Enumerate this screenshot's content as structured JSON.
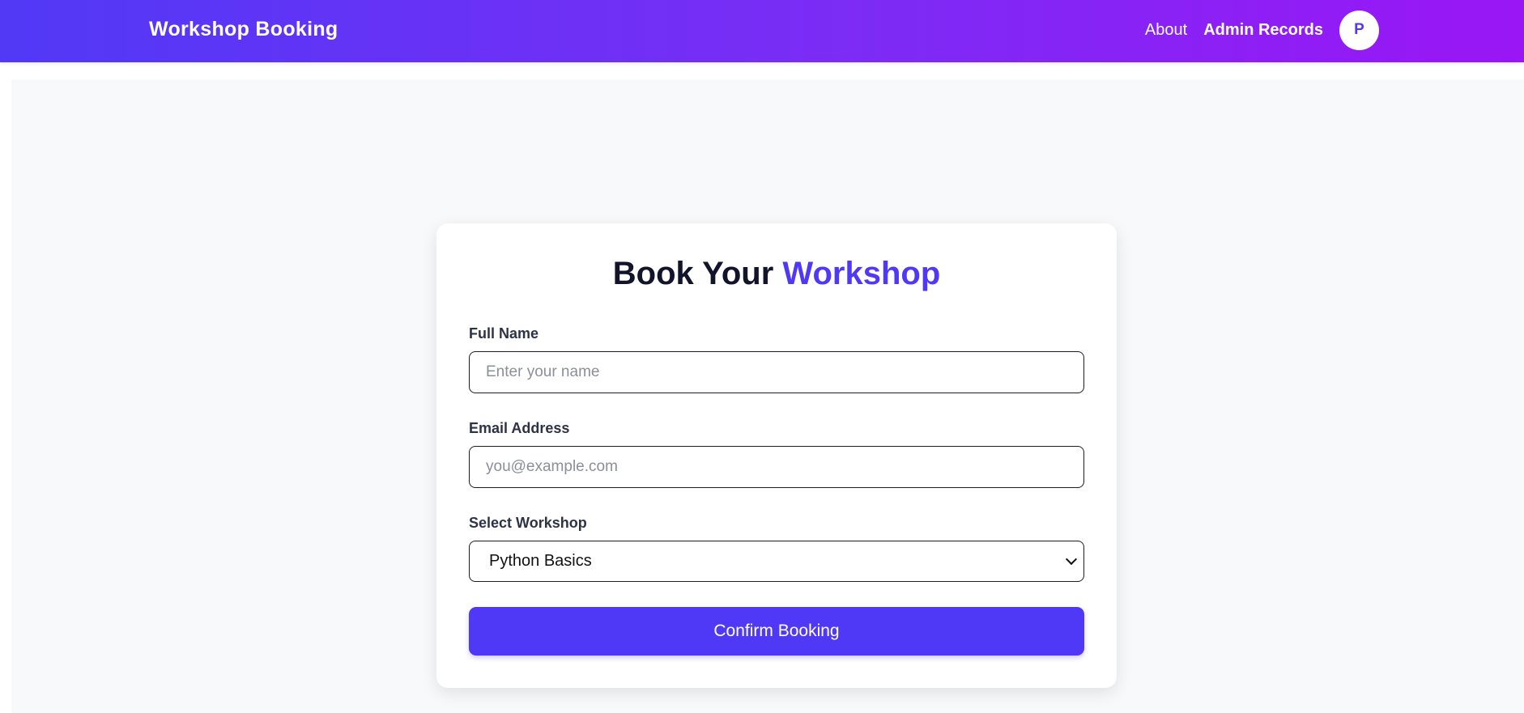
{
  "header": {
    "brand": "Workshop Booking",
    "nav": {
      "about": "About",
      "admin_records": "Admin Records"
    },
    "avatar_initial": "P"
  },
  "form": {
    "title_part1": "Book Your",
    "title_part2": "Workshop",
    "name": {
      "label": "Full Name",
      "placeholder": "Enter your name",
      "value": ""
    },
    "email": {
      "label": "Email Address",
      "placeholder": "you@example.com",
      "value": ""
    },
    "workshop": {
      "label": "Select Workshop",
      "selected": "Python Basics"
    },
    "submit_label": "Confirm Booking"
  },
  "colors": {
    "accent": "#4f39f6",
    "gradient_start": "#5139f6",
    "gradient_end": "#9a16f5",
    "page_background": "#f8f9fb"
  },
  "icons": {
    "select_chevron": "chevron-down-icon"
  }
}
